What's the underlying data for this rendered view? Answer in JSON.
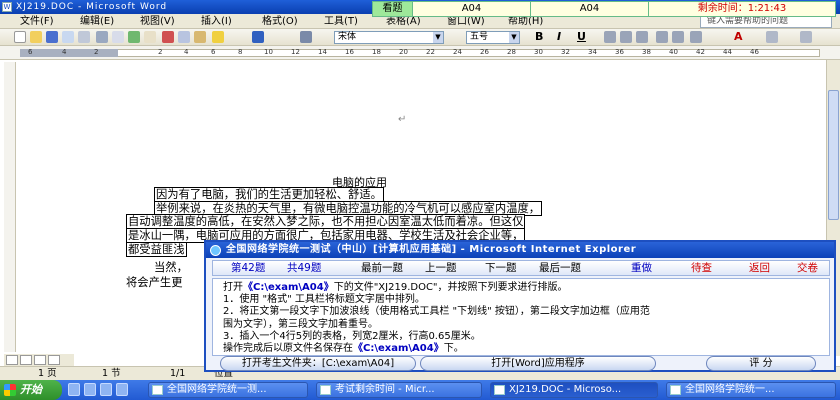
{
  "window": {
    "title": "XJ219.DOC - Microsoft Word"
  },
  "exam_bar": {
    "label": "看题",
    "field1": "A04",
    "field2": "A04",
    "timer": "剩余时间：1:21:43"
  },
  "menu": {
    "items": [
      "文件(F)",
      "编辑(E)",
      "视图(V)",
      "插入(I)",
      "格式(O)",
      "工具(T)",
      "表格(A)",
      "窗口(W)",
      "帮助(H)"
    ],
    "help_placeholder": "键入需要帮助的问题"
  },
  "toolbar": {
    "font": "宋体",
    "size": "五号",
    "bold": "B",
    "italic": "I",
    "underline": "U",
    "font_color": "A"
  },
  "ruler": {
    "numbers": [
      "6",
      "4",
      "2",
      "2",
      "4",
      "6",
      "8",
      "10",
      "12",
      "14",
      "16",
      "18",
      "20",
      "22",
      "24",
      "26",
      "28",
      "30",
      "32",
      "34",
      "36",
      "38",
      "40",
      "42",
      "44",
      "46"
    ]
  },
  "document": {
    "title": "电脑的应用",
    "lines": [
      "因为有了电脑，我们的生活更加轻松、舒适。",
      "举例来说，在炎热的天气里，有微电脑控温功能的冷气机可以感应室内温度，",
      "自动调整温度的高低，在安然入梦之际，也不用担心因室温太低而着凉。但这仅",
      "是冰山一隅，电脑可应用的方面很广，包括家用电器、学校生活及社会企业等，",
      "都受益匪浅",
      "当然，",
      "将会产生更"
    ]
  },
  "dialog": {
    "title": "全国网络学院统一测试（中山）[计算机应用基础] - Microsoft Internet Explorer",
    "nav": {
      "current_num": "第42题",
      "total": "共49题",
      "first": "最前一题",
      "prev": "上一题",
      "next": "下一题",
      "last": "最后一题",
      "redo": "重做",
      "pending": "待查",
      "back": "返回",
      "submit": "交卷"
    },
    "body": {
      "l1_pre": "打开",
      "l1_path": "《C:\\exam\\A04》",
      "l1_mid": "下的文件\"XJ219.DOC\"，并按照下列要求进行排版。",
      "l2": "1．使用 \"格式\" 工具栏将标题文字居中排列。",
      "l3": "2．将正文第一段文字下加波浪线（使用格式工具栏 \"下划线\" 按钮），第二段文字加边框（应用范",
      "l4": "围为文字），第三段文字加着重号。",
      "l5": "3．插入一个4行5列的表格，列宽2厘米，行高0.65厘米。",
      "l6_pre": "操作完成后以原文件名保存在",
      "l6_path": "《C:\\exam\\A04》",
      "l6_post": "下。"
    },
    "buttons": {
      "open_folder": "打开考生文件夹：[C:\\exam\\A04]",
      "open_app": "打开[Word]应用程序",
      "score": "评  分"
    }
  },
  "status": {
    "page": "1 页",
    "section": "1 节",
    "pages": "1/1",
    "at": "位置"
  },
  "taskbar": {
    "start": "开始",
    "tasks": [
      "全国网络学院统一测...",
      "考试剩余时间 - Micr...",
      "XJ219.DOC - Microso...",
      "全国网络学院统一..."
    ]
  },
  "colors": {
    "accent": "#1d4fc0",
    "timer": "#d00000",
    "path": "#0000c0"
  }
}
